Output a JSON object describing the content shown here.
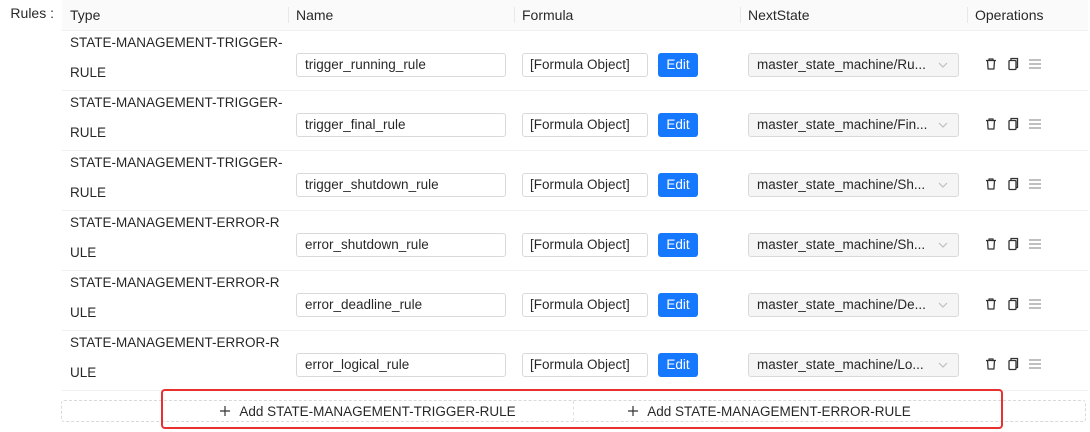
{
  "form": {
    "rules_label": "Rules :"
  },
  "table": {
    "headers": {
      "type": "Type",
      "name": "Name",
      "formula": "Formula",
      "next_state": "NextState",
      "operations": "Operations"
    },
    "rows": [
      {
        "type": "STATE-MANAGEMENT-TRIGGER-RULE",
        "name": "trigger_running_rule",
        "formula": "[Formula Object]",
        "edit": "Edit",
        "next_state": "master_state_machine/Ru..."
      },
      {
        "type": "STATE-MANAGEMENT-TRIGGER-RULE",
        "name": "trigger_final_rule",
        "formula": "[Formula Object]",
        "edit": "Edit",
        "next_state": "master_state_machine/Fin..."
      },
      {
        "type": "STATE-MANAGEMENT-TRIGGER-RULE",
        "name": "trigger_shutdown_rule",
        "formula": "[Formula Object]",
        "edit": "Edit",
        "next_state": "master_state_machine/Sh..."
      },
      {
        "type": "STATE-MANAGEMENT-ERROR-RULE",
        "name": "error_shutdown_rule",
        "formula": "[Formula Object]",
        "edit": "Edit",
        "next_state": "master_state_machine/Sh..."
      },
      {
        "type": "STATE-MANAGEMENT-ERROR-RULE",
        "name": "error_deadline_rule",
        "formula": "[Formula Object]",
        "edit": "Edit",
        "next_state": "master_state_machine/De..."
      },
      {
        "type": "STATE-MANAGEMENT-ERROR-RULE",
        "name": "error_logical_rule",
        "formula": "[Formula Object]",
        "edit": "Edit",
        "next_state": "master_state_machine/Lo..."
      }
    ]
  },
  "add_buttons": {
    "trigger": "Add STATE-MANAGEMENT-TRIGGER-RULE",
    "error": "Add STATE-MANAGEMENT-ERROR-RULE"
  },
  "icons": {
    "delete": "trash-icon",
    "copy": "copy-icon",
    "drag": "drag-handle-icon",
    "select": "chevron-down-icon",
    "add": "plus-icon"
  },
  "colors": {
    "primary": "#1677ff",
    "highlight": "#e8312f"
  }
}
